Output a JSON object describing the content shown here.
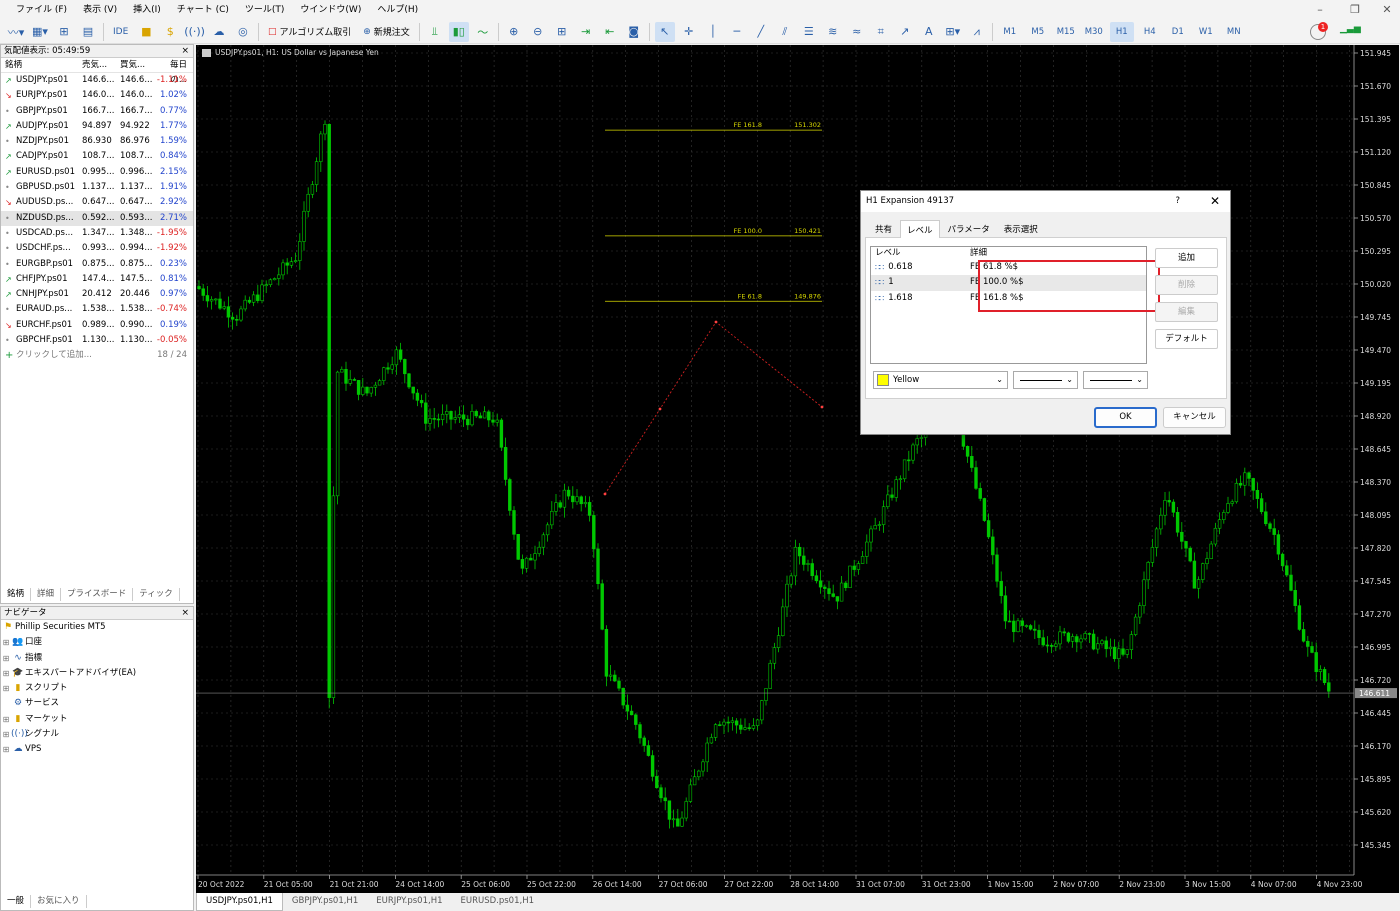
{
  "menu": [
    "ファイル (F)",
    "表示 (V)",
    "挿入(I)",
    "チャート (C)",
    "ツール(T)",
    "ウインドウ(W)",
    "ヘルプ(H)"
  ],
  "toolbar": {
    "ide": "IDE",
    "algo": "アルゴリズム取引",
    "new_order": "新規注文",
    "timeframes": [
      "M1",
      "M5",
      "M15",
      "M30",
      "H1",
      "H4",
      "D1",
      "W1",
      "MN"
    ],
    "active_timeframe": "H1",
    "notifications": "1"
  },
  "market_watch": {
    "title": "気配値表示: 05:49:59",
    "headers": [
      "銘柄",
      "売気...",
      "買気...",
      "毎日の..."
    ],
    "rows": [
      {
        "sym": "USDJPY.ps01",
        "bid": "146.6...",
        "ask": "146.6...",
        "chg": "-1.11%",
        "dir": "up"
      },
      {
        "sym": "EURJPY.ps01",
        "bid": "146.0...",
        "ask": "146.0...",
        "chg": "1.02%",
        "dir": "dn"
      },
      {
        "sym": "GBPJPY.ps01",
        "bid": "166.7...",
        "ask": "166.7...",
        "chg": "0.77%",
        "dir": "dot"
      },
      {
        "sym": "AUDJPY.ps01",
        "bid": "94.897",
        "ask": "94.922",
        "chg": "1.77%",
        "dir": "up"
      },
      {
        "sym": "NZDJPY.ps01",
        "bid": "86.930",
        "ask": "86.976",
        "chg": "1.59%",
        "dir": "dot"
      },
      {
        "sym": "CADJPY.ps01",
        "bid": "108.7...",
        "ask": "108.7...",
        "chg": "0.84%",
        "dir": "up"
      },
      {
        "sym": "EURUSD.ps01",
        "bid": "0.995...",
        "ask": "0.996...",
        "chg": "2.15%",
        "dir": "up"
      },
      {
        "sym": "GBPUSD.ps01",
        "bid": "1.137...",
        "ask": "1.137...",
        "chg": "1.91%",
        "dir": "dot"
      },
      {
        "sym": "AUDUSD.ps...",
        "bid": "0.647...",
        "ask": "0.647...",
        "chg": "2.92%",
        "dir": "dn"
      },
      {
        "sym": "NZDUSD.ps...",
        "bid": "0.592...",
        "ask": "0.593...",
        "chg": "2.71%",
        "dir": "dot"
      },
      {
        "sym": "USDCAD.ps...",
        "bid": "1.347...",
        "ask": "1.348...",
        "chg": "-1.95%",
        "dir": "dot"
      },
      {
        "sym": "USDCHF.ps...",
        "bid": "0.993...",
        "ask": "0.994...",
        "chg": "-1.92%",
        "dir": "dot"
      },
      {
        "sym": "EURGBP.ps01",
        "bid": "0.875...",
        "ask": "0.875...",
        "chg": "0.23%",
        "dir": "dot"
      },
      {
        "sym": "CHFJPY.ps01",
        "bid": "147.4...",
        "ask": "147.5...",
        "chg": "0.81%",
        "dir": "up"
      },
      {
        "sym": "CNHJPY.ps01",
        "bid": "20.412",
        "ask": "20.446",
        "chg": "0.97%",
        "dir": "up"
      },
      {
        "sym": "EURAUD.ps...",
        "bid": "1.538...",
        "ask": "1.538...",
        "chg": "-0.74%",
        "dir": "dot"
      },
      {
        "sym": "EURCHF.ps01",
        "bid": "0.989...",
        "ask": "0.990...",
        "chg": "0.19%",
        "dir": "dn"
      },
      {
        "sym": "GBPCHF.ps01",
        "bid": "1.130...",
        "ask": "1.130...",
        "chg": "-0.05%",
        "dir": "dot"
      }
    ],
    "add_label": "クリックして追加...",
    "count": "18 / 24",
    "tabs": [
      "銘柄",
      "詳細",
      "プライスボード",
      "ティック"
    ]
  },
  "navigator": {
    "title": "ナビゲータ",
    "root": "Phillip Securities MT5",
    "items": [
      "口座",
      "指標",
      "エキスパートアドバイザ(EA)",
      "スクリプト",
      "サービス",
      "マーケット",
      "シグナル",
      "VPS"
    ],
    "tabs": [
      "一般",
      "お気に入り"
    ]
  },
  "chart": {
    "title": "USDJPY.ps01, H1:  US Dollar vs Japanese Yen",
    "price_labels": [
      "151.945",
      "151.670",
      "151.395",
      "151.120",
      "150.845",
      "150.570",
      "150.295",
      "150.020",
      "149.745",
      "149.470",
      "149.195",
      "148.920",
      "148.645",
      "148.370",
      "148.095",
      "147.820",
      "147.545",
      "147.270",
      "146.995",
      "146.720",
      "146.445",
      "146.170",
      "145.895",
      "145.620",
      "145.345"
    ],
    "current_price": "146.611",
    "time_labels": [
      "20 Oct 2022",
      "21 Oct 05:00",
      "21 Oct 21:00",
      "24 Oct 14:00",
      "25 Oct 06:00",
      "25 Oct 22:00",
      "26 Oct 14:00",
      "27 Oct 06:00",
      "27 Oct 22:00",
      "28 Oct 14:00",
      "31 Oct 07:00",
      "31 Oct 23:00",
      "1 Nov 15:00",
      "2 Nov 07:00",
      "2 Nov 23:00",
      "3 Nov 15:00",
      "4 Nov 07:00",
      "4 Nov 23:00"
    ],
    "fe_levels": [
      {
        "label": "FE 161.8",
        "value": "151.302"
      },
      {
        "label": "FE 100.0",
        "value": "150.421"
      },
      {
        "label": "FE 61.8",
        "value": "149.876"
      }
    ],
    "tabs": [
      "USDJPY.ps01,H1",
      "GBPJPY.ps01,H1",
      "EURJPY.ps01,H1",
      "EURUSD.ps01,H1"
    ],
    "colors": {
      "bg": "#000000",
      "candle": "#00c800",
      "level": "#d8d800",
      "grid": "#3a3a3a"
    }
  },
  "dialog": {
    "title": "H1 Expansion 49137",
    "help": "?",
    "tabs": [
      "共有",
      "レベル",
      "パラメータ",
      "表示選択"
    ],
    "active_tab": "レベル",
    "columns": [
      "レベル",
      "詳細"
    ],
    "levels": [
      {
        "level": "0.618",
        "desc": "FE 61.8  %$"
      },
      {
        "level": "1",
        "desc": "FE 100.0  %$"
      },
      {
        "level": "1.618",
        "desc": "FE 161.8  %$"
      }
    ],
    "buttons": {
      "add": "追加",
      "delete": "削除",
      "edit": "編集",
      "default": "デフォルト",
      "ok": "OK",
      "cancel": "キャンセル"
    },
    "color_name": "Yellow"
  }
}
